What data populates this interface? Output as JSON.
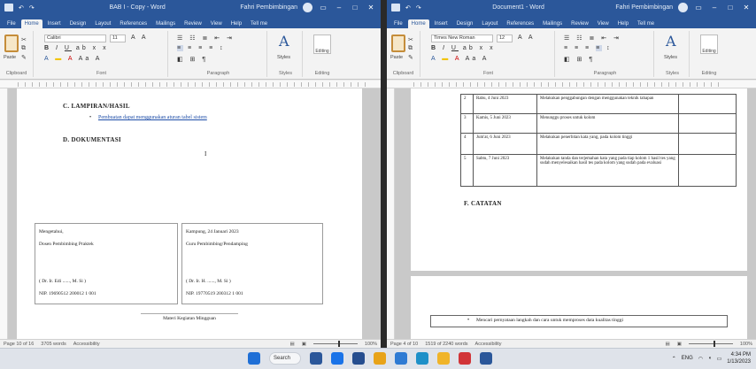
{
  "left_window": {
    "title": "BAB I - Copy - Word",
    "user": "Fahri Pembimbingan",
    "tabs": [
      "File",
      "Home",
      "Insert",
      "Design",
      "Layout",
      "References",
      "Mailings",
      "Review",
      "View",
      "Help",
      "Tell me"
    ],
    "font_name": "Calibri",
    "font_size": "11",
    "groups": {
      "clipboard": "Clipboard",
      "font": "Font",
      "paragraph": "Paragraph",
      "styles": "Styles",
      "editing": "Editing"
    },
    "paste_label": "Paste",
    "styles_label": "Styles",
    "editing_label": "Editing",
    "page": {
      "heading_c": "C. LAMPIRAN/HASIL",
      "bullet_link": "Pembuatan dapat menggunakan aturan tabel sistem",
      "heading_d": "D. DOKUMENTASI",
      "cursor_mark": "I",
      "sig_left": {
        "line1": "Mengetahui,",
        "line2": "Dosen Pembimbing Praktek",
        "name": "( Dr. Ir. Edi ......, M. Si )",
        "nip": "NIP. 19690512 200012 1 001"
      },
      "sig_right": {
        "line1": "Kampung, 24 Januari 2023",
        "line2": "Guru Pembimbing/Pendamping",
        "name": "( Dr. Ir. H. ......, M. Si )",
        "nip": "NIP. 19770519 200312 1 001"
      },
      "footer_text": "Materi Kegiatan Mingguan"
    },
    "status": {
      "page": "Page 10 of 16",
      "words": "3705 words",
      "accessibility": "Accessibility",
      "zoom": "100%"
    }
  },
  "right_window": {
    "title": "Document1 - Word",
    "user": "Fahri Pembimbingan",
    "tabs": [
      "File",
      "Home",
      "Insert",
      "Design",
      "Layout",
      "References",
      "Mailings",
      "Review",
      "View",
      "Help",
      "Tell me"
    ],
    "font_name": "Times New Roman",
    "font_size": "12",
    "groups": {
      "clipboard": "Clipboard",
      "font": "Font",
      "paragraph": "Paragraph",
      "styles": "Styles",
      "editing": "Editing"
    },
    "paste_label": "Paste",
    "styles_label": "Styles",
    "editing_label": "Editing",
    "table": {
      "rows": [
        {
          "no": "2",
          "date": "Rabu, 4 Juni 2023",
          "activity": "Melakukan penggabungan dengan menggunakan teknik tahapan"
        },
        {
          "no": "3",
          "date": "Kamis, 5 Juni 2023",
          "activity": "Menunggu proses untuk kolom"
        },
        {
          "no": "4",
          "date": "Jum'at, 6 Juni 2023",
          "activity": "Melakukan penerbitan kata yang, pada kolom tinggi"
        },
        {
          "no": "5",
          "date": "Sabtu, 7 Juni 2023",
          "activity": "Melakukan tanda dan terjemahan kata yang pada tiap kolom 1 hasil tes yang sudah menyelesaikan hasil tes pada kolom yang sudah pada evaluasi"
        }
      ]
    },
    "heading_f": "F. CATATAN",
    "bottom_bullet": "Mencari pernyataan langkah dan cara untuk memproses data kualitas tinggi",
    "status": {
      "page": "Page 4 of 10",
      "words": "1519 of 2240 words",
      "accessibility": "Accessibility",
      "zoom": "100%"
    }
  },
  "taskbar": {
    "search": "Search",
    "lang": "ENG",
    "time": "4:34 PM",
    "date": "1/13/2023"
  }
}
